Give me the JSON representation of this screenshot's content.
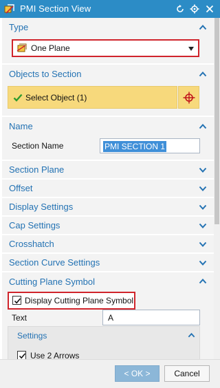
{
  "window": {
    "title": "PMI Section View",
    "app_icon": "pmi-section-view-icon",
    "buttons": [
      "reset-icon",
      "settings-icon",
      "close-icon"
    ]
  },
  "sections": {
    "type": {
      "label": "Type",
      "state": "expanded",
      "selected": "One Plane",
      "selected_icon": "one-plane-icon"
    },
    "objects": {
      "label": "Objects to Section",
      "state": "expanded",
      "select_label": "Select Object (1)",
      "status_icon": "check-icon",
      "picker_icon": "crosshair-icon"
    },
    "name": {
      "label": "Name",
      "state": "expanded",
      "field_label": "Section Name",
      "field_value": "PMI SECTION 1"
    },
    "collapsed": [
      {
        "label": "Section Plane"
      },
      {
        "label": "Offset"
      },
      {
        "label": "Display Settings"
      },
      {
        "label": "Cap Settings"
      },
      {
        "label": "Crosshatch"
      },
      {
        "label": "Section Curve Settings"
      }
    ],
    "cutting_plane": {
      "label": "Cutting Plane Symbol",
      "state": "expanded",
      "display_checkbox_label": "Display Cutting Plane Symbol",
      "display_checked": true,
      "text_label": "Text",
      "text_value": "A",
      "settings": {
        "label": "Settings",
        "state": "expanded",
        "use_arrows_label": "Use 2 Arrows",
        "use_arrows_checked": true
      }
    }
  },
  "footer": {
    "ok_label": "< OK >",
    "cancel_label": "Cancel"
  },
  "colors": {
    "titlebar": "#2c8cc6",
    "section_label": "#2372b3",
    "highlight_border": "#d0242b",
    "select_row": "#f7d97c",
    "ok_button": "#8cb7d8"
  }
}
